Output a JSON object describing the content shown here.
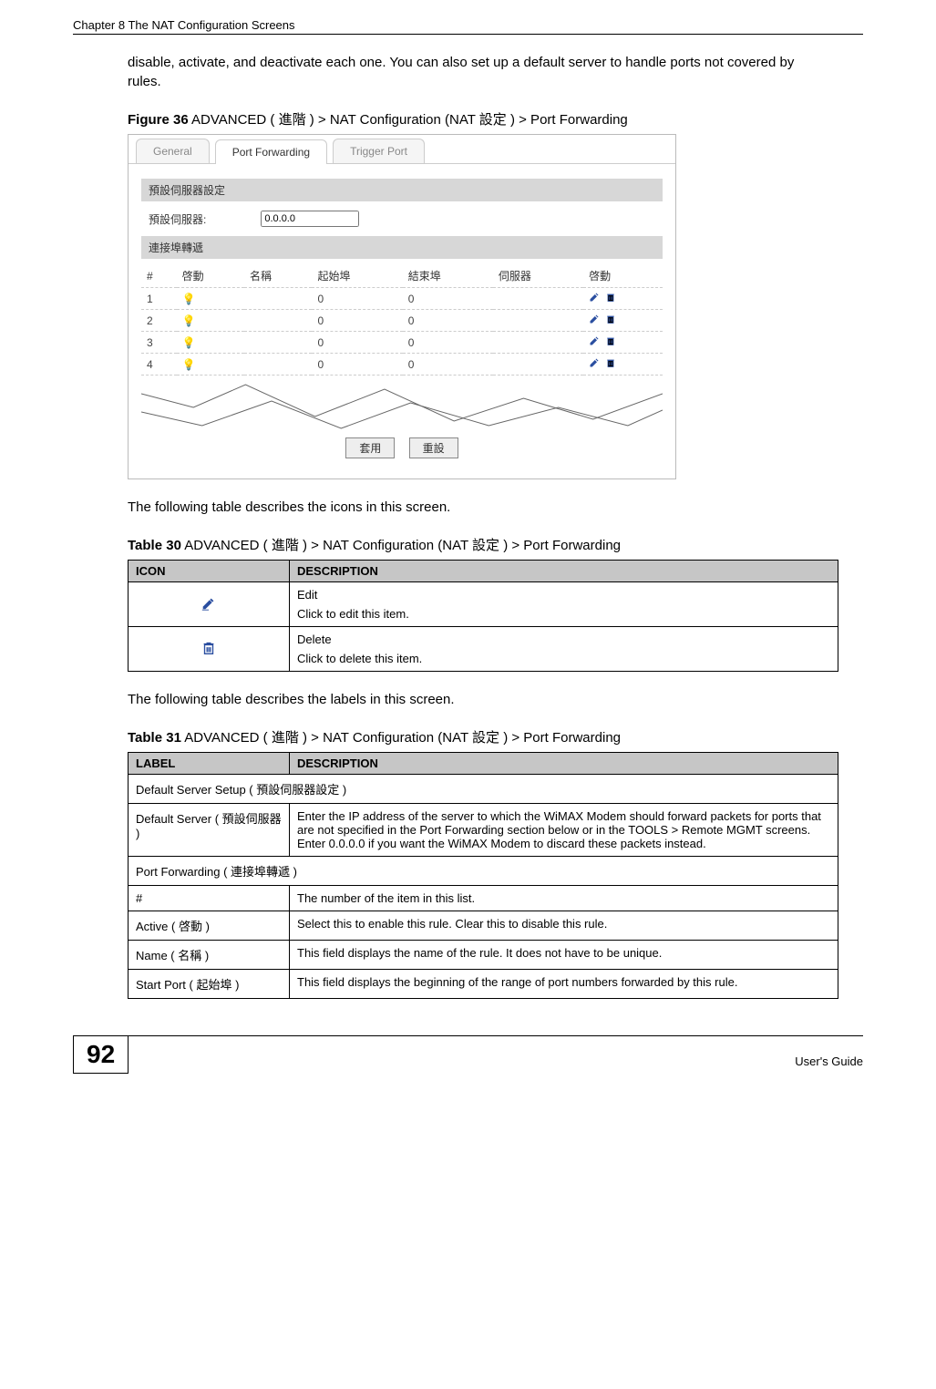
{
  "header": {
    "running": "Chapter 8 The NAT Configuration Screens"
  },
  "intro": "disable, activate, and deactivate each one. You can also set up a default server to handle ports not covered by rules.",
  "figure36": {
    "caption_bold": "Figure 36",
    "caption_rest": "   ADVANCED ( 進階 ) > NAT Configuration (NAT 設定 ) > Port Forwarding",
    "tabs": {
      "general": "General",
      "pf": "Port Forwarding",
      "tp": "Trigger Port"
    },
    "sec_default": "預設伺服器設定",
    "default_label": "預設伺服器:",
    "default_value": "0.0.0.0",
    "sec_pf": "連接埠轉遞",
    "cols": {
      "num": "#",
      "active": "啓動",
      "name": "名稱",
      "start": "起始埠",
      "end": "結束埠",
      "server": "伺服器",
      "action": "啓動"
    },
    "rows": [
      {
        "n": "1",
        "s": "0",
        "e": "0"
      },
      {
        "n": "2",
        "s": "0",
        "e": "0"
      },
      {
        "n": "3",
        "s": "0",
        "e": "0"
      },
      {
        "n": "4",
        "s": "0",
        "e": "0"
      }
    ],
    "btn_apply": "套用",
    "btn_reset": "重設"
  },
  "mid1": "The following table describes the icons in this screen.",
  "table30": {
    "caption_bold": "Table 30",
    "caption_rest": "   ADVANCED ( 進階 ) > NAT Configuration (NAT 設定 )  > Port Forwarding",
    "h_icon": "ICON",
    "h_desc": "DESCRIPTION",
    "edit_t": "Edit",
    "edit_d": "Click to edit this item.",
    "del_t": "Delete",
    "del_d": "Click to delete this item."
  },
  "mid2": "The following table describes the labels in this screen.",
  "table31": {
    "caption_bold": "Table 31",
    "caption_rest": "   ADVANCED ( 進階 ) > NAT Configuration (NAT 設定 )  > Port Forwarding",
    "h_label": "LABEL",
    "h_desc": "DESCRIPTION",
    "sect1": "Default Server Setup ( 預設伺服器設定 )",
    "r1l": "Default Server ( 預設伺服器 )",
    "r1d": "Enter the IP address of the server to which the WiMAX Modem should forward packets for ports that are not specified in the Port Forwarding section below or in the TOOLS > Remote MGMT screens. Enter 0.0.0.0 if you want the WiMAX Modem to discard these packets instead.",
    "sect2": "Port Forwarding ( 連接埠轉遞 )",
    "r2l": "#",
    "r2d": "The number of the item in this list.",
    "r3l": "Active ( 啓動 )",
    "r3d": "Select this to enable this rule. Clear this to disable this rule.",
    "r4l": "Name ( 名稱 )",
    "r4d": "This field displays the name of the rule. It does not have to be unique.",
    "r5l": "Start Port ( 起始埠 )",
    "r5d": "This field displays the beginning of the range of port numbers forwarded by this rule."
  },
  "footer": {
    "page": "92",
    "guide": "User's Guide"
  }
}
